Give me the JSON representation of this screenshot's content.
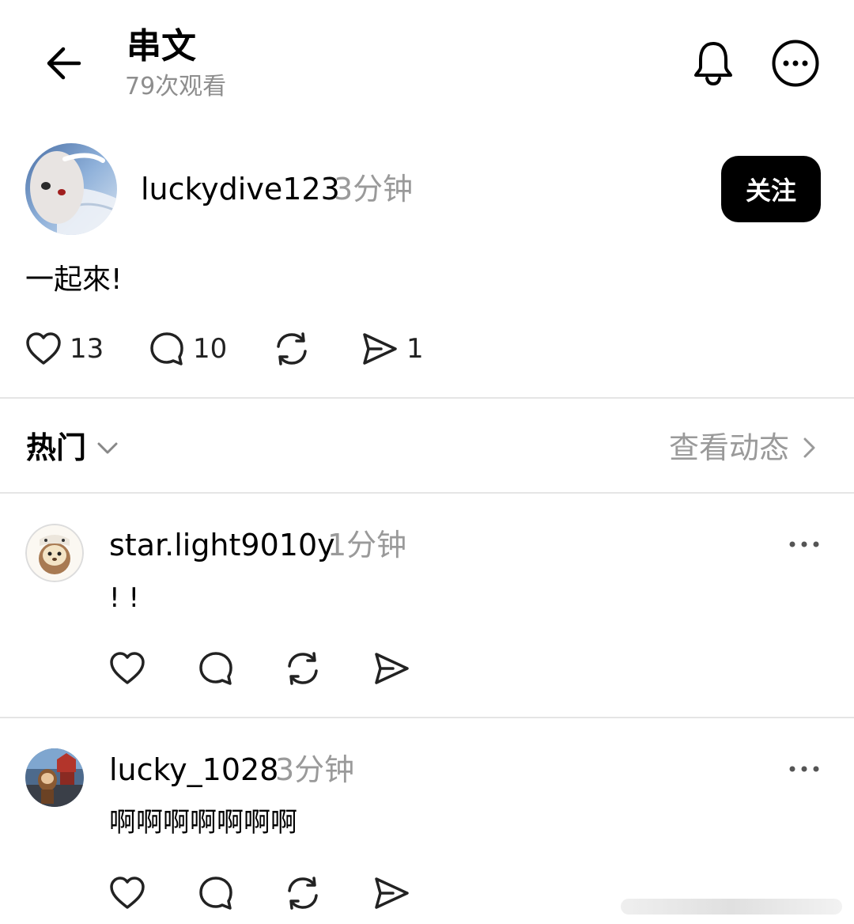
{
  "header": {
    "title": "串文",
    "views": "79次观看",
    "back_icon": "arrow-left-icon",
    "bell_icon": "bell-icon",
    "more_icon": "more-circle-icon"
  },
  "post": {
    "username": "luckydive123",
    "time": "3分钟",
    "follow_label": "关注",
    "text": "一起來!",
    "likes": "13",
    "comments": "10",
    "shares": "1"
  },
  "sort": {
    "label": "热门",
    "activity_link": "查看动态"
  },
  "replies": [
    {
      "username": "star.light9010y",
      "time": "1分钟",
      "text": "!  !"
    },
    {
      "username": "lucky_1028",
      "time": "3分钟",
      "text": "啊啊啊啊啊啊啊"
    }
  ],
  "colors": {
    "text": "#000000",
    "muted": "#9a9a9a",
    "divider": "#e5e5e5",
    "follow_bg": "#000000"
  }
}
